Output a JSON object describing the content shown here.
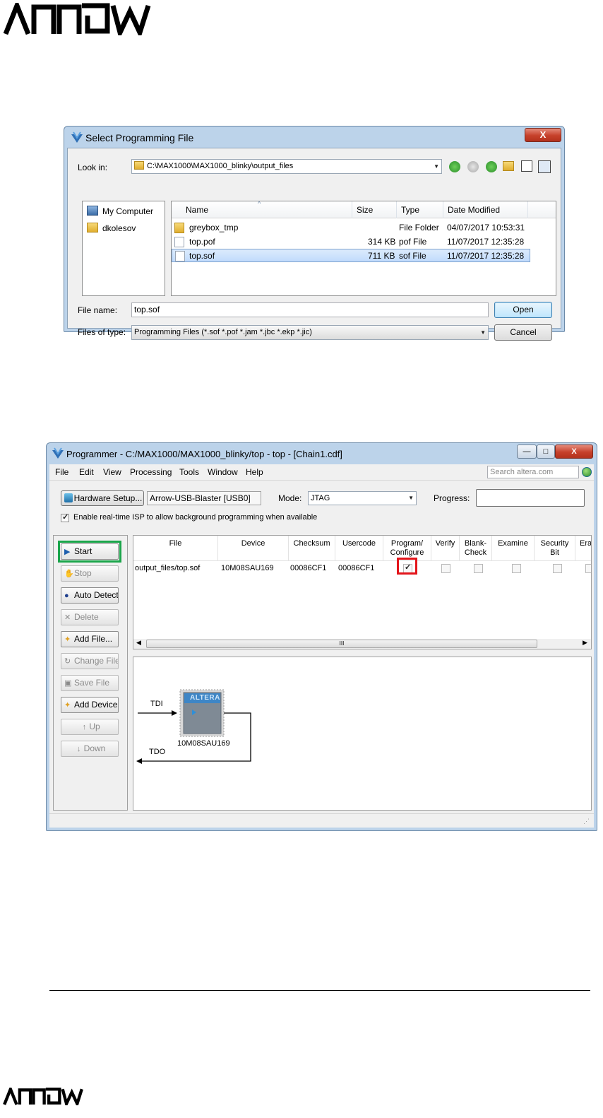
{
  "branding": {
    "logo_text": "ARROW"
  },
  "dialog": {
    "title": "Select Programming File",
    "close_label": "X",
    "look_in_label": "Look in:",
    "look_in_value": "C:\\MAX1000\\MAX1000_blinky\\output_files",
    "places": [
      {
        "label": "My Computer",
        "icon": "computer-icon"
      },
      {
        "label": "dkolesov",
        "icon": "user-folder-icon"
      }
    ],
    "columns": [
      "Name",
      "Size",
      "Type",
      "Date Modified"
    ],
    "files": [
      {
        "name": "greybox_tmp",
        "size": "",
        "type": "File Folder",
        "date": "04/07/2017 10:53:31",
        "icon": "folder-icon"
      },
      {
        "name": "top.pof",
        "size": "314 KB",
        "type": "pof File",
        "date": "11/07/2017 12:35:28",
        "icon": "file-icon"
      },
      {
        "name": "top.sof",
        "size": "711 KB",
        "type": "sof File",
        "date": "11/07/2017 12:35:28",
        "icon": "file-icon",
        "selected": true
      }
    ],
    "filename_label": "File name:",
    "filename_value": "top.sof",
    "filetype_label": "Files of type:",
    "filetype_value": "Programming Files (*.sof *.pof *.jam *.jbc *.ekp *.jic)",
    "open_label": "Open",
    "cancel_label": "Cancel"
  },
  "programmer": {
    "title": "Programmer - C:/MAX1000/MAX1000_blinky/top - top - [Chain1.cdf]",
    "window_controls": {
      "minimize": "—",
      "maximize": "□",
      "close": "X"
    },
    "menu": [
      "File",
      "Edit",
      "View",
      "Processing",
      "Tools",
      "Window",
      "Help"
    ],
    "search_placeholder": "Search altera.com",
    "hardware_setup_label": "Hardware Setup...",
    "hardware_value": "Arrow-USB-Blaster [USB0]",
    "mode_label": "Mode:",
    "mode_value": "JTAG",
    "progress_label": "Progress:",
    "isp_label": "Enable real-time ISP to allow background programming when available",
    "isp_checked": true,
    "buttons": [
      {
        "label": "Start",
        "enabled": true,
        "icon": "start-icon"
      },
      {
        "label": "Stop",
        "enabled": false,
        "icon": "stop-icon"
      },
      {
        "label": "Auto Detect",
        "enabled": true,
        "icon": "binoculars-icon"
      },
      {
        "label": "Delete",
        "enabled": false,
        "icon": "delete-icon"
      },
      {
        "label": "Add File...",
        "enabled": true,
        "icon": "add-file-icon"
      },
      {
        "label": "Change File",
        "enabled": false,
        "icon": "change-file-icon"
      },
      {
        "label": "Save File",
        "enabled": false,
        "icon": "save-file-icon"
      },
      {
        "label": "Add Device...",
        "enabled": true,
        "icon": "add-device-icon"
      },
      {
        "label": "Up",
        "enabled": false,
        "icon": "up-icon"
      },
      {
        "label": "Down",
        "enabled": false,
        "icon": "down-icon"
      }
    ],
    "grid_headers": [
      "File",
      "Device",
      "Checksum",
      "Usercode",
      "Program/\nConfigure",
      "Verify",
      "Blank-\nCheck",
      "Examine",
      "Security\nBit",
      "Eras"
    ],
    "row": {
      "file": "output_files/top.sof",
      "device": "10M08SAU169",
      "checksum": "00086CF1",
      "usercode": "00086CF1",
      "program_configure": true,
      "verify": false,
      "blank_check": false,
      "examine": false,
      "security_bit": false,
      "erase": false
    },
    "scroll_grip": "III",
    "chain": {
      "tdi": "TDI",
      "tdo": "TDO",
      "chip_label": "10M08SAU169",
      "chip_brand": "ALTERA"
    }
  },
  "colors": {
    "highlight_start": "#1aa54a",
    "highlight_program": "#e3151b",
    "brand": "#000000"
  }
}
